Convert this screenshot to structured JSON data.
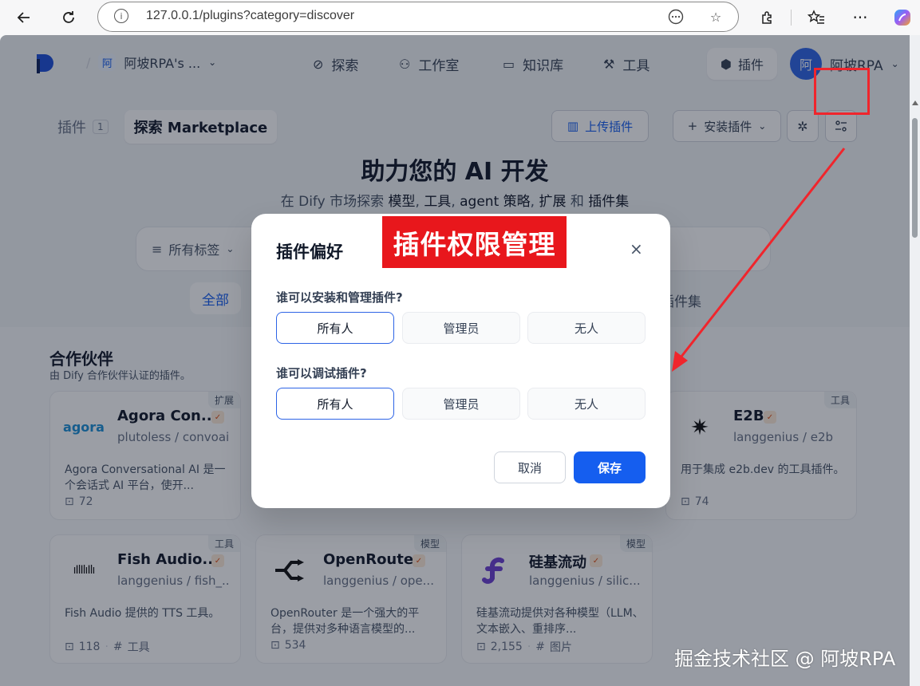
{
  "browser": {
    "url": "127.0.0.1/plugins?category=discover"
  },
  "nav": {
    "workspace_avatar": "阿",
    "workspace_name": "阿坡RPA's ...",
    "links": [
      {
        "label": "探索"
      },
      {
        "label": "工作室"
      },
      {
        "label": "知识库"
      },
      {
        "label": "工具"
      }
    ],
    "plugins_label": "插件",
    "user_avatar": "阿",
    "user_name": "阿坡RPA"
  },
  "toolbar": {
    "tab_plugins": "插件",
    "tab_plugins_count": "1",
    "tab_marketplace": "探索 Marketplace",
    "upload_label": "上传插件",
    "install_label": "安装插件"
  },
  "hero": {
    "title": "助力您的 AI 开发",
    "subtitle_parts": [
      "在 Dify 市场探索 ",
      "模型",
      ", ",
      "工具",
      ", ",
      "agent 策略",
      ", ",
      "扩展",
      " 和 ",
      "插件集"
    ],
    "tags_label": "所有标签",
    "cat_all": "全部",
    "cat_bundle": "插件集"
  },
  "partners": {
    "title": "合作伙伴",
    "subtitle": "由 Dify 合作伙伴认证的插件。"
  },
  "cards": [
    {
      "name": "Agora Con...",
      "org": "plutoless",
      "repo": "convoai",
      "badge": "扩展",
      "desc": "Agora Conversational AI 是一个会话式 AI 平台，使开...",
      "installs": "72",
      "tag": ""
    },
    {
      "name": "E2B",
      "org": "langgenius",
      "repo": "e2b",
      "badge": "工具",
      "desc": "用于集成 e2b.dev 的工具插件。",
      "installs": "74",
      "tag": ""
    },
    {
      "name": "Fish Audio...",
      "org": "langgenius",
      "repo": "fish_...",
      "badge": "工具",
      "desc": "Fish Audio 提供的 TTS 工具。",
      "installs": "118",
      "tag": "工具"
    },
    {
      "name": "OpenRouter",
      "org": "langgenius",
      "repo": "ope...",
      "badge": "模型",
      "desc": "OpenRouter 是一个强大的平台，提供对多种语言模型的...",
      "installs": "534",
      "tag": ""
    },
    {
      "name": "硅基流动",
      "org": "langgenius",
      "repo": "silic...",
      "badge": "模型",
      "desc": "硅基流动提供对各种模型（LLM、文本嵌入、重排序...",
      "installs": "2,155",
      "tag": "图片"
    }
  ],
  "modal": {
    "title": "插件偏好",
    "q1": "谁可以安装和管理插件?",
    "q2": "谁可以调试插件?",
    "options": [
      "所有人",
      "管理员",
      "无人"
    ],
    "q1_selected": "所有人",
    "q2_selected": "所有人",
    "cancel": "取消",
    "save": "保存",
    "close": "×"
  },
  "annotation": {
    "label": "插件权限管理",
    "color": "#e8171c"
  },
  "watermark": "掘金技术社区 @ 阿坡RPA",
  "colors": {
    "primary": "#155eef",
    "annotation_red": "#f0252c"
  }
}
